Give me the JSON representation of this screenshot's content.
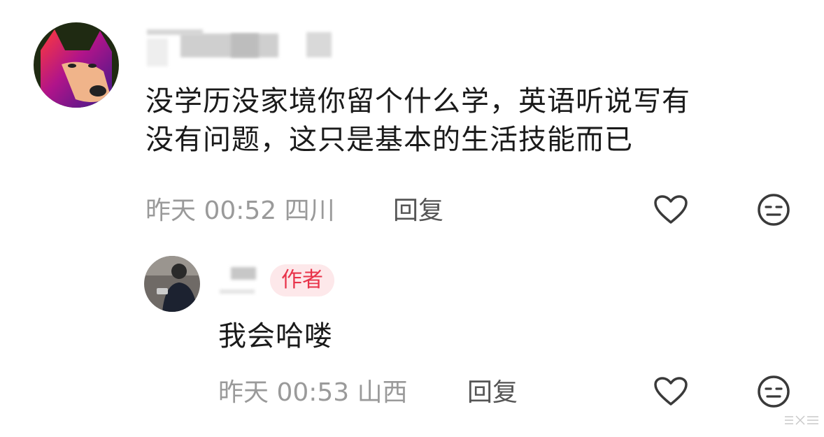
{
  "comment": {
    "text": "没学历没家境你留个什么学，英语听说写有没有问题，这只是基本的生活技能而已",
    "text_line1": "没学历没家境你留个什么学，英语听说写有",
    "text_line2": "没有问题，这只是基本的生活技能而已",
    "time": "昨天 00:52",
    "location": "四川",
    "reply_label": "回复",
    "like_icon": "heart-icon",
    "dislike_icon": "neutral-face-icon"
  },
  "reply": {
    "author_badge": "作者",
    "text": "我会哈喽",
    "time": "昨天 00:53",
    "location": "山西",
    "reply_label": "回复",
    "like_icon": "heart-icon",
    "dislike_icon": "neutral-face-icon"
  },
  "colors": {
    "badge_text": "#e8334a",
    "badge_bg": "#fde8ea",
    "meta_text": "#9a9a9a"
  }
}
